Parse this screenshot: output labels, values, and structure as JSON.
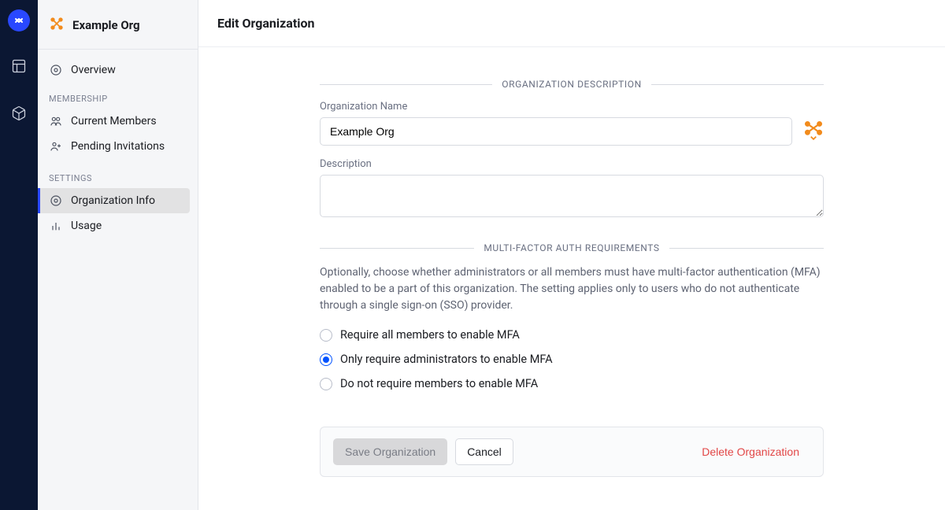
{
  "org_name": "Example Org",
  "page_title": "Edit Organization",
  "sidebar": {
    "overview": "Overview",
    "group_membership": "Membership",
    "current_members": "Current Members",
    "pending_invitations": "Pending Invitations",
    "group_settings": "Settings",
    "organization_info": "Organization Info",
    "usage": "Usage"
  },
  "sections": {
    "description": "Organization Description",
    "mfa": "Multi-Factor Auth Requirements"
  },
  "fields": {
    "org_name_label": "Organization Name",
    "org_name_value": "Example Org",
    "description_label": "Description",
    "description_value": ""
  },
  "mfa": {
    "help": "Optionally, choose whether administrators or all members must have multi-factor authentication (MFA) enabled to be a part of this organization. The setting applies only to users who do not authenticate through a single sign-on (SSO) provider.",
    "options": {
      "all": "Require all members to enable MFA",
      "admins": "Only require administrators to enable MFA",
      "none": "Do not require members to enable MFA"
    },
    "selected": "admins"
  },
  "actions": {
    "save": "Save Organization",
    "cancel": "Cancel",
    "delete": "Delete Organization"
  }
}
